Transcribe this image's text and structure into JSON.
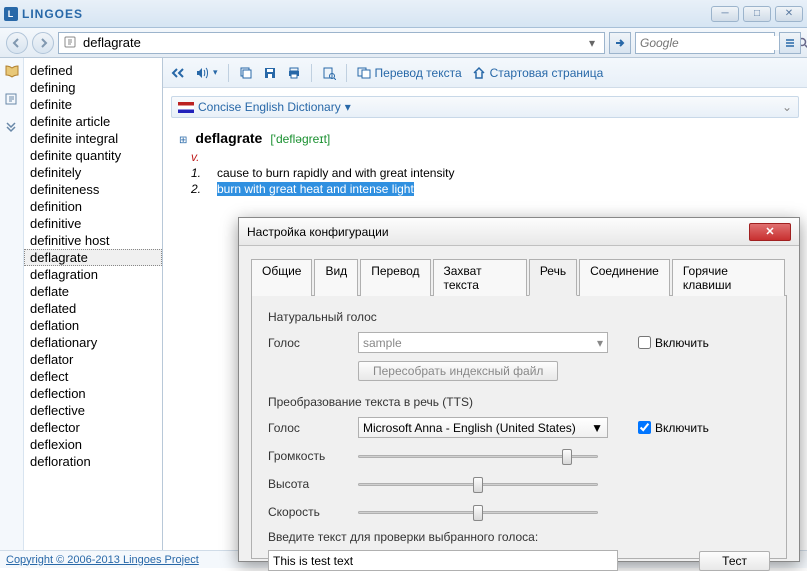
{
  "app": {
    "name": "LINGOES"
  },
  "search": {
    "value": "deflagrate",
    "google_placeholder": "Google"
  },
  "toolbar": {
    "translate": "Перевод текста",
    "home": "Стартовая страница"
  },
  "dictionary": {
    "name": "Concise English Dictionary"
  },
  "entry": {
    "word": "deflagrate",
    "phonetic": "['defləgreɪt]",
    "pos": "v.",
    "defs": [
      {
        "n": "1.",
        "text": "cause to burn rapidly and with great intensity"
      },
      {
        "n": "2.",
        "text": "burn with great heat and intense light"
      }
    ]
  },
  "wordlist": [
    "defined",
    "defining",
    "definite",
    "definite article",
    "definite integral",
    "definite quantity",
    "definitely",
    "definiteness",
    "definition",
    "definitive",
    "definitive host",
    "deflagrate",
    "deflagration",
    "deflate",
    "deflated",
    "deflation",
    "deflationary",
    "deflator",
    "deflect",
    "deflection",
    "deflective",
    "deflector",
    "deflexion",
    "defloration"
  ],
  "wordlist_selected": "deflagrate",
  "dialog": {
    "title": "Настройка конфигурации",
    "tabs": [
      "Общие",
      "Вид",
      "Перевод",
      "Захват текста",
      "Речь",
      "Соединение",
      "Горячие клавиши"
    ],
    "active_tab": "Речь",
    "natural": {
      "title": "Натуральный голос",
      "voice_label": "Голос",
      "voice_value": "sample",
      "rebuild": "Пересобрать индексный файл",
      "enable": "Включить",
      "enabled": false
    },
    "tts": {
      "title": "Преобразование текста в речь (TTS)",
      "voice_label": "Голос",
      "voice_value": "Microsoft Anna - English (United States)",
      "volume_label": "Громкость",
      "pitch_label": "Высота",
      "speed_label": "Скорость",
      "enable": "Включить",
      "enabled": true,
      "volume": 85,
      "pitch": 50,
      "speed": 50,
      "test_label": "Введите текст для проверки выбранного голоса:",
      "test_value": "This is test text",
      "test_btn": "Тест"
    }
  },
  "footer": {
    "copyright": "Copyright © 2006-2013 Lingoes Project"
  }
}
